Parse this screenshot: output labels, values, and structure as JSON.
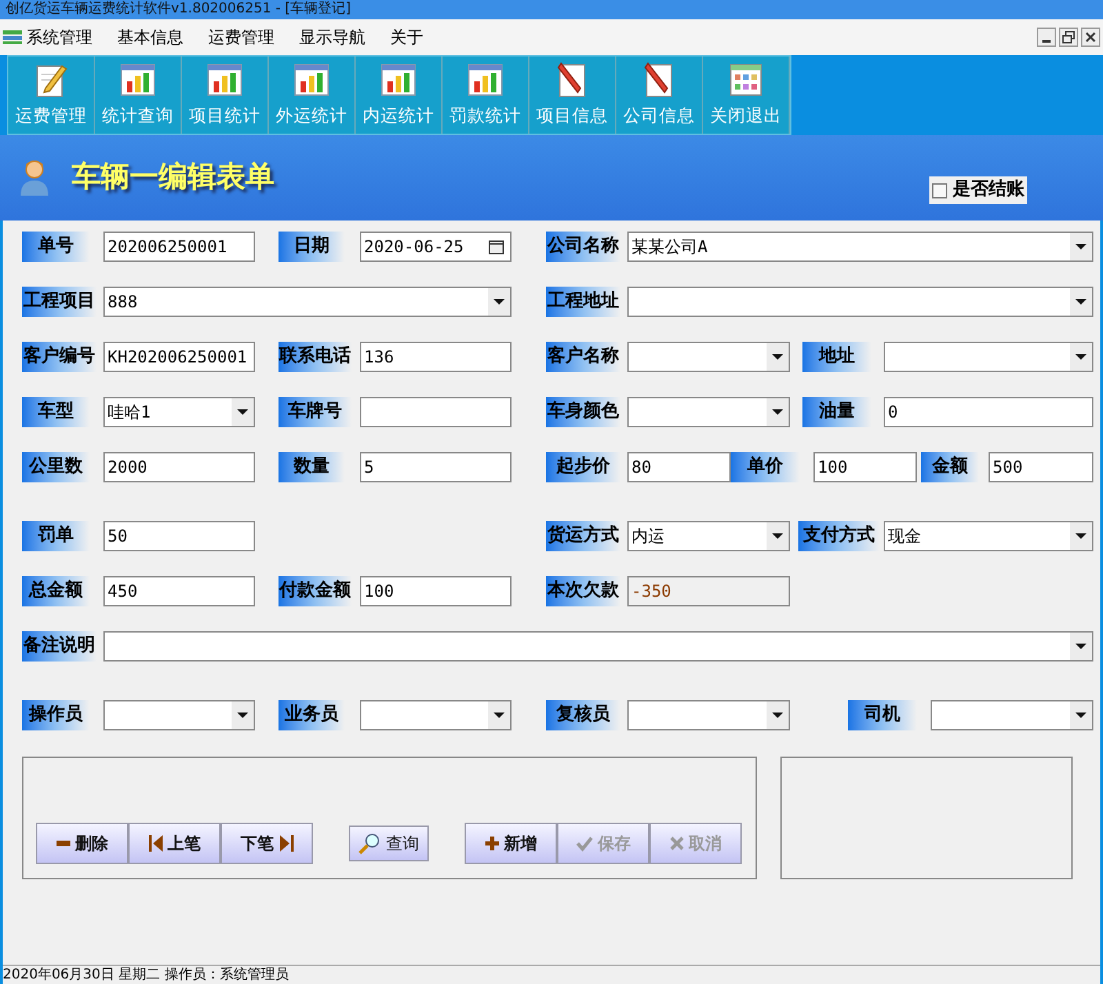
{
  "window": {
    "title": "创亿货运车辆运费统计软件v1.802006251 - [车辆登记]"
  },
  "menu": [
    "系统管理",
    "基本信息",
    "运费管理",
    "显示导航",
    "关于"
  ],
  "toolbar": [
    {
      "label": "运费管理",
      "kind": "edit"
    },
    {
      "label": "统计查询",
      "kind": "chart"
    },
    {
      "label": "项目统计",
      "kind": "chart"
    },
    {
      "label": "外运统计",
      "kind": "chart"
    },
    {
      "label": "内运统计",
      "kind": "chart"
    },
    {
      "label": "罚款统计",
      "kind": "chart"
    },
    {
      "label": "项目信息",
      "kind": "document"
    },
    {
      "label": "公司信息",
      "kind": "document"
    },
    {
      "label": "关闭退出",
      "kind": "grid"
    }
  ],
  "header": {
    "title": "车辆一编辑表单",
    "settled": {
      "label": "是否结账",
      "checked": false
    }
  },
  "form_rows": [
    [
      {
        "label": "单号",
        "kind": "text",
        "value": "202006250001"
      },
      {
        "label": "日期",
        "kind": "date",
        "value": "2020-06-25"
      },
      {
        "label": "公司名称",
        "kind": "combo",
        "value": "某某公司A"
      }
    ],
    [
      {
        "label": "工程项目",
        "kind": "combo",
        "value": "888"
      },
      {
        "label": "工程地址",
        "kind": "combo"
      }
    ],
    [
      {
        "label": "客户编号",
        "kind": "text",
        "value": "KH202006250001"
      },
      {
        "label": "联系电话",
        "kind": "text",
        "value": "136"
      },
      {
        "label": "客户名称",
        "kind": "combo"
      },
      {
        "label": "地址",
        "kind": "combo"
      }
    ],
    [
      {
        "label": "车型",
        "kind": "combo",
        "value": "哇哈1"
      },
      {
        "label": "车牌号",
        "kind": "text"
      },
      {
        "label": "车身颜色",
        "kind": "combo"
      },
      {
        "label": "油量",
        "kind": "text",
        "value": "0"
      }
    ],
    [
      {
        "label": "公里数",
        "kind": "text",
        "value": "2000"
      },
      {
        "label": "数量",
        "kind": "text",
        "value": "5"
      },
      {
        "label": "起步价",
        "kind": "text",
        "value": "80"
      },
      {
        "label": "单价",
        "kind": "text",
        "value": "100"
      },
      {
        "label": "金额",
        "kind": "text",
        "value": "500"
      }
    ],
    [
      {
        "label": "罚单",
        "kind": "text",
        "value": "50"
      },
      {
        "label": "货运方式",
        "kind": "combo",
        "value": "内运"
      },
      {
        "label": "支付方式",
        "kind": "combo",
        "value": "现金"
      }
    ],
    [
      {
        "label": "总金额",
        "kind": "text",
        "value": "450"
      },
      {
        "label": "付款金额",
        "kind": "text",
        "value": "100"
      },
      {
        "label": "本次欠款",
        "kind": "readonly",
        "value": "-350"
      }
    ],
    [
      {
        "label": "备注说明",
        "kind": "combo"
      }
    ],
    [
      {
        "label": "操作员",
        "kind": "combo"
      },
      {
        "label": "业务员",
        "kind": "combo"
      },
      {
        "label": "复核员",
        "kind": "combo"
      },
      {
        "label": "司机",
        "kind": "combo"
      }
    ]
  ],
  "button_groups": [
    [
      {
        "label": "删除",
        "kind": "minus",
        "disabled": false
      },
      {
        "label": "上笔",
        "kind": "prev",
        "disabled": false
      },
      {
        "label": "下笔",
        "kind": "next",
        "disabled": false
      }
    ],
    [
      {
        "label": "查询",
        "kind": "search",
        "disabled": false
      }
    ],
    [
      {
        "label": "新增",
        "kind": "plus",
        "disabled": false
      },
      {
        "label": "保存",
        "kind": "check",
        "disabled": true
      },
      {
        "label": "取消",
        "kind": "cross",
        "disabled": true
      }
    ]
  ],
  "status_bar": "2020年06月30日  星期二  操作员：系统管理员"
}
